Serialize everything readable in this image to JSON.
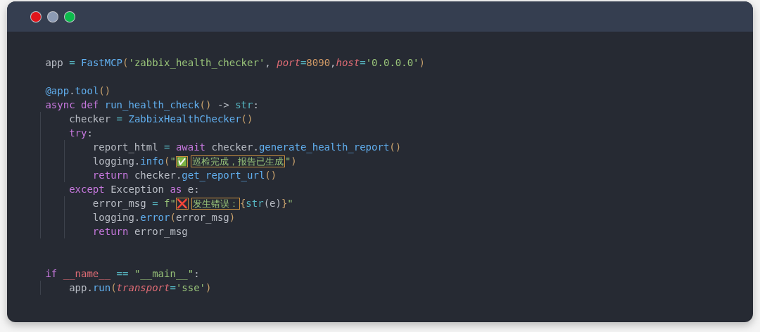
{
  "window": {
    "buttons": [
      {
        "color": "#e0151b"
      },
      {
        "color": "#8c9bb5"
      },
      {
        "color": "#0dba4c"
      }
    ]
  },
  "code": {
    "blocks": [
      {
        "lines": [
          {
            "tokens": [
              {
                "t": "app ",
                "kind": "plain"
              },
              {
                "t": "=",
                "kind": "operator"
              },
              {
                "t": " FastMCP",
                "kind": "function"
              },
              {
                "t": "(",
                "kind": "paren"
              },
              {
                "t": "'zabbix_health_checker'",
                "kind": "string"
              },
              {
                "t": ", ",
                "kind": "plain"
              },
              {
                "t": "port",
                "kind": "param"
              },
              {
                "t": "=",
                "kind": "operator"
              },
              {
                "t": "8090",
                "kind": "number"
              },
              {
                "t": ",",
                "kind": "plain"
              },
              {
                "t": "host",
                "kind": "param"
              },
              {
                "t": "=",
                "kind": "operator"
              },
              {
                "t": "'0.0.0.0'",
                "kind": "string"
              },
              {
                "t": ")",
                "kind": "paren"
              }
            ]
          }
        ]
      },
      {
        "lines": [
          {
            "tokens": [
              {
                "t": "@app",
                "kind": "function"
              },
              {
                "t": ".",
                "kind": "plain"
              },
              {
                "t": "tool",
                "kind": "function"
              },
              {
                "t": "()",
                "kind": "paren"
              }
            ]
          },
          {
            "tokens": [
              {
                "t": "async def",
                "kind": "keyword"
              },
              {
                "t": " run_health_check",
                "kind": "function"
              },
              {
                "t": "()",
                "kind": "paren"
              },
              {
                "t": " -> ",
                "kind": "plain"
              },
              {
                "t": "str",
                "kind": "builtin"
              },
              {
                "t": ":",
                "kind": "plain"
              }
            ]
          },
          {
            "tokens": [
              {
                "t": "    checker ",
                "kind": "plain"
              },
              {
                "t": "=",
                "kind": "operator"
              },
              {
                "t": " ZabbixHealthChecker",
                "kind": "function"
              },
              {
                "t": "()",
                "kind": "paren"
              }
            ]
          },
          {
            "tokens": [
              {
                "t": "    try",
                "kind": "keyword"
              },
              {
                "t": ":",
                "kind": "plain"
              }
            ]
          },
          {
            "tokens": [
              {
                "t": "        report_html ",
                "kind": "plain"
              },
              {
                "t": "=",
                "kind": "operator"
              },
              {
                "t": " await",
                "kind": "keyword"
              },
              {
                "t": " checker.",
                "kind": "plain"
              },
              {
                "t": "generate_health_report",
                "kind": "function"
              },
              {
                "t": "()",
                "kind": "paren"
              }
            ]
          },
          {
            "tokens": [
              {
                "t": "        logging.",
                "kind": "plain"
              },
              {
                "t": "info",
                "kind": "function"
              },
              {
                "t": "(",
                "kind": "paren"
              },
              {
                "t": "\"",
                "kind": "string"
              },
              {
                "t": "✅",
                "kind": "emoji-check"
              },
              {
                "t": "巡检完成，报告已生成",
                "kind": "boxed"
              },
              {
                "t": "\"",
                "kind": "string"
              },
              {
                "t": ")",
                "kind": "paren"
              }
            ]
          },
          {
            "tokens": [
              {
                "t": "        return",
                "kind": "keyword"
              },
              {
                "t": " checker.",
                "kind": "plain"
              },
              {
                "t": "get_report_url",
                "kind": "function"
              },
              {
                "t": "()",
                "kind": "paren"
              }
            ]
          },
          {
            "tokens": [
              {
                "t": "    except",
                "kind": "keyword"
              },
              {
                "t": " Exception ",
                "kind": "plain"
              },
              {
                "t": "as",
                "kind": "keyword"
              },
              {
                "t": " e:",
                "kind": "plain"
              }
            ]
          },
          {
            "tokens": [
              {
                "t": "        error_msg ",
                "kind": "plain"
              },
              {
                "t": "=",
                "kind": "operator"
              },
              {
                "t": " f\"",
                "kind": "string"
              },
              {
                "t": "❌",
                "kind": "emoji-cross"
              },
              {
                "t": "发生错误：",
                "kind": "boxed"
              },
              {
                "t": "{",
                "kind": "paren"
              },
              {
                "t": "str",
                "kind": "builtin"
              },
              {
                "t": "(e)",
                "kind": "plain"
              },
              {
                "t": "}",
                "kind": "paren"
              },
              {
                "t": "\"",
                "kind": "string"
              }
            ]
          },
          {
            "tokens": [
              {
                "t": "        logging.",
                "kind": "plain"
              },
              {
                "t": "error",
                "kind": "function"
              },
              {
                "t": "(",
                "kind": "paren"
              },
              {
                "t": "error_msg",
                "kind": "plain"
              },
              {
                "t": ")",
                "kind": "paren"
              }
            ]
          },
          {
            "tokens": [
              {
                "t": "        return",
                "kind": "keyword"
              },
              {
                "t": " error_msg",
                "kind": "plain"
              }
            ]
          }
        ]
      },
      {
        "lines": [
          {
            "tokens": [
              {
                "t": "if",
                "kind": "keyword"
              },
              {
                "t": " __name__ ",
                "kind": "dunder"
              },
              {
                "t": "==",
                "kind": "operator"
              },
              {
                "t": " \"__main__\"",
                "kind": "string"
              },
              {
                "t": ":",
                "kind": "plain"
              }
            ]
          },
          {
            "tokens": [
              {
                "t": "    app.",
                "kind": "plain"
              },
              {
                "t": "run",
                "kind": "function"
              },
              {
                "t": "(",
                "kind": "paren"
              },
              {
                "t": "transport",
                "kind": "param"
              },
              {
                "t": "=",
                "kind": "operator"
              },
              {
                "t": "'sse'",
                "kind": "string"
              },
              {
                "t": ")",
                "kind": "paren"
              }
            ]
          }
        ]
      }
    ]
  }
}
